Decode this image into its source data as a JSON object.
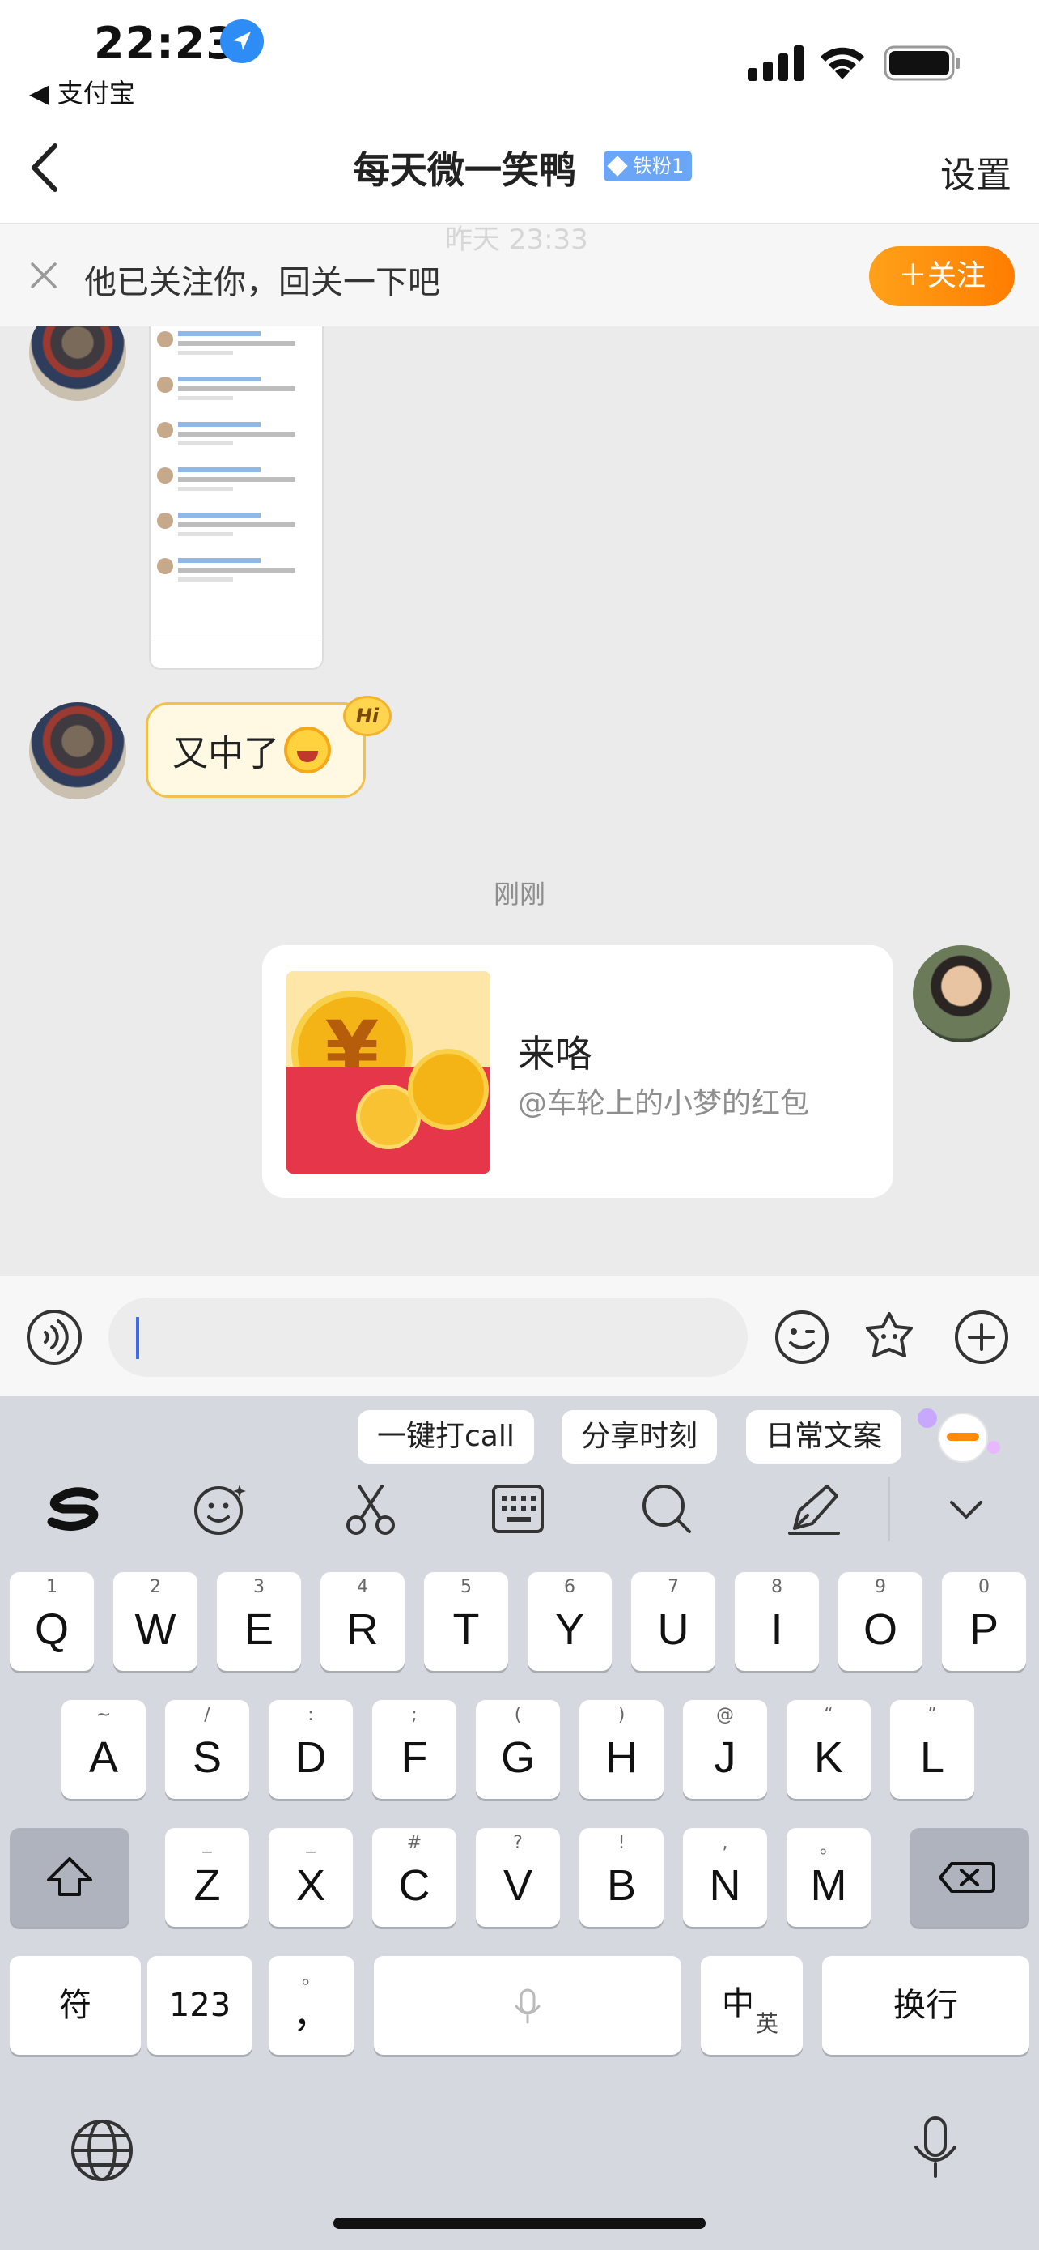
{
  "status_bar": {
    "time": "22:23",
    "back_app": "◀ 支付宝"
  },
  "nav": {
    "title": "每天微一笑鸭",
    "badge": "铁粉1",
    "settings": "设置"
  },
  "banner": {
    "text": "他已关注你，回关一下吧",
    "ghost_time": "昨天 23:33",
    "follow_button": "＋关注"
  },
  "messages": {
    "other_text": "又中了",
    "hi_badge": "Hi",
    "time_label": "刚刚",
    "redpacket_title": "来咯",
    "redpacket_sub": "@车轮上的小梦的红包",
    "coin_symbol": "¥"
  },
  "input": {
    "value": "",
    "placeholder": ""
  },
  "keyboard": {
    "suggestions": [
      "一键打call",
      "分享时刻",
      "日常文案"
    ],
    "row1": [
      [
        "Q",
        "1"
      ],
      [
        "W",
        "2"
      ],
      [
        "E",
        "3"
      ],
      [
        "R",
        "4"
      ],
      [
        "T",
        "5"
      ],
      [
        "Y",
        "6"
      ],
      [
        "U",
        "7"
      ],
      [
        "I",
        "8"
      ],
      [
        "O",
        "9"
      ],
      [
        "P",
        "0"
      ]
    ],
    "row2": [
      [
        "A",
        "~"
      ],
      [
        "S",
        "/"
      ],
      [
        "D",
        ":"
      ],
      [
        "F",
        ";"
      ],
      [
        "G",
        "("
      ],
      [
        "H",
        ")"
      ],
      [
        "J",
        "@"
      ],
      [
        "K",
        "“"
      ],
      [
        "L",
        "”"
      ]
    ],
    "row3": [
      [
        "Z",
        "_"
      ],
      [
        "X",
        "_"
      ],
      [
        "C",
        "#"
      ],
      [
        "V",
        "?"
      ],
      [
        "B",
        "!"
      ],
      [
        "N",
        ","
      ],
      [
        "M",
        "。"
      ]
    ],
    "symbol_key": "符",
    "num_key": "123",
    "punct_key": "，",
    "punct_sub": "。",
    "lang_key_main": "中",
    "lang_key_sub": "英",
    "return_key": "换行"
  },
  "colors": {
    "accent_orange": "#ff8a0d",
    "bubble_border": "#f3c04c",
    "caret": "#3a6cf6",
    "badge_blue": "#6aa6f5"
  }
}
